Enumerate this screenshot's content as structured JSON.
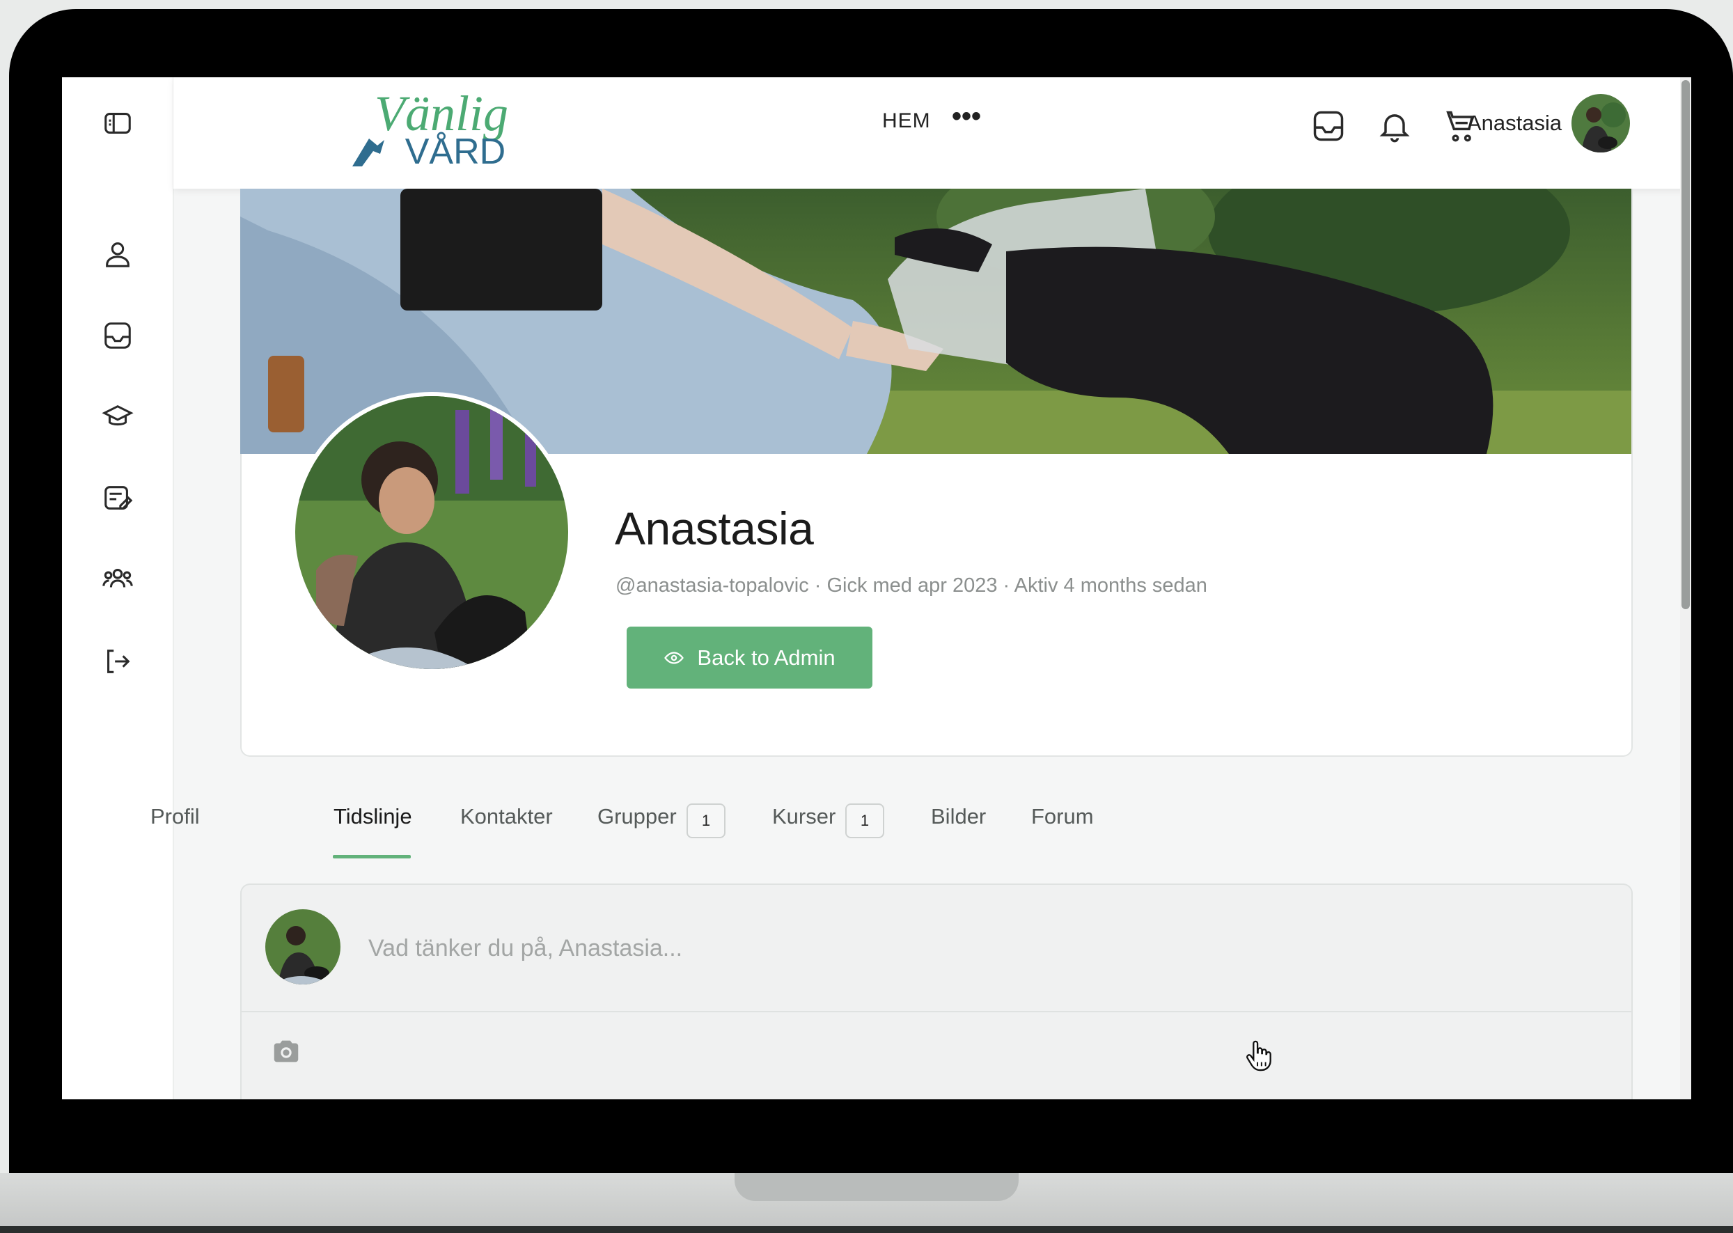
{
  "header": {
    "logo_line1": "Vänlig",
    "logo_line2": "VÅRD",
    "nav_home": "HEM",
    "nav_more": "•••",
    "user_name": "Anastasia"
  },
  "sidebar": {
    "items": [
      {
        "icon": "sidebar-toggle-icon"
      },
      {
        "icon": "user-icon"
      },
      {
        "icon": "inbox-icon"
      },
      {
        "icon": "graduation-cap-icon"
      },
      {
        "icon": "notes-edit-icon"
      },
      {
        "icon": "group-icon"
      },
      {
        "icon": "logout-icon"
      }
    ]
  },
  "profile": {
    "name": "Anastasia",
    "meta": "@anastasia-topalovic · Gick med apr 2023 · Aktiv 4 months sedan",
    "admin_button": "Back to Admin"
  },
  "tabs": [
    {
      "label": "Profil"
    },
    {
      "label": "Tidslinje",
      "active": true
    },
    {
      "label": "Kontakter"
    },
    {
      "label": "Grupper",
      "count": "1"
    },
    {
      "label": "Kurser",
      "count": "1"
    },
    {
      "label": "Bilder"
    },
    {
      "label": "Forum"
    }
  ],
  "composer": {
    "placeholder": "Vad tänker du på, Anastasia..."
  },
  "colors": {
    "accent": "#62b27a",
    "logo_green": "#4caa73",
    "logo_blue": "#2f6d8f"
  }
}
